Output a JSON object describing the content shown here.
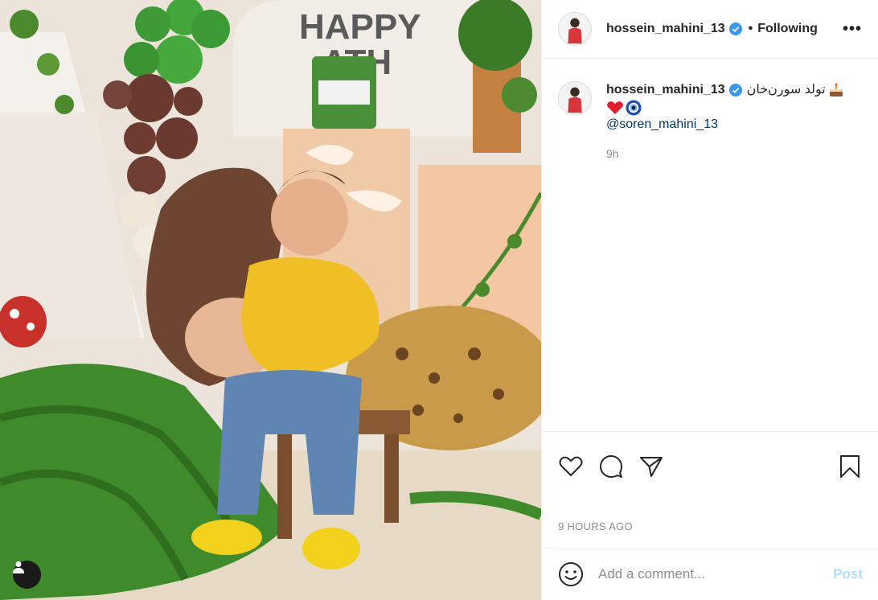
{
  "post": {
    "photo_description_icon": "image-photo",
    "tag_icon": "user-tag-icon"
  },
  "header": {
    "username": "hossein_mahini_13",
    "separator": "•",
    "follow_status": "Following",
    "more_label": "•••"
  },
  "caption": {
    "username": "hossein_mahini_13",
    "text": "تولد سورن‌خان",
    "mention": "@soren_mahini_13",
    "time": "9h"
  },
  "actions": {
    "icons": [
      "heart-icon",
      "comment-icon",
      "share-icon",
      "bookmark-icon"
    ]
  },
  "timestamp": "9 HOURS AGO",
  "comment": {
    "placeholder": "Add a comment...",
    "post_label": "Post"
  },
  "colors": {
    "verified": "#3897f0",
    "link": "#00376b",
    "post_disabled": "#b2dffc",
    "muted": "#8e8e8e"
  }
}
